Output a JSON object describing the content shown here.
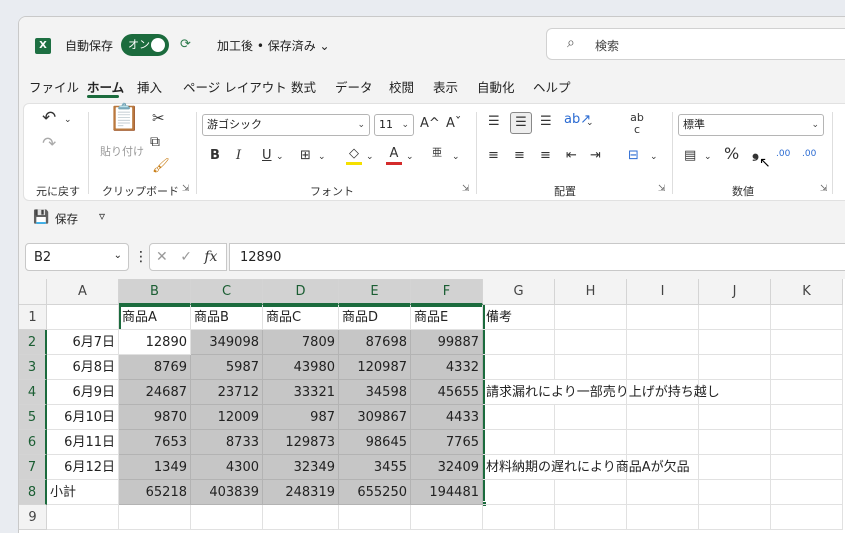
{
  "app": {
    "logo_letter": "X",
    "autosave_label": "自動保存",
    "autosave_state": "オン",
    "document_title": "加工後 • 保存済み ⌄",
    "search_placeholder": "検索"
  },
  "menu": [
    "ファイル",
    "ホーム",
    "挿入",
    "ページ レイアウト",
    "数式",
    "データ",
    "校閲",
    "表示",
    "自動化",
    "ヘルプ"
  ],
  "ribbon": {
    "undo_group": "元に戻す",
    "clipboard_group": "クリップボード",
    "paste_label": "貼り付け",
    "font_group": "フォント",
    "font_name": "游ゴシック",
    "font_size": "11",
    "align_group": "配置",
    "number_group": "数値",
    "number_format": "標準",
    "grow_font": "A^",
    "shrink_font": "Aˇ",
    "bold": "B",
    "italic": "I",
    "underline": "U",
    "font_color": "A",
    "percent": "%",
    "comma": "❟",
    "inc_decimal": ".00",
    "dec_decimal": ".00",
    "wrap": "ab c"
  },
  "qbar": {
    "save": "保存",
    "more": "▿"
  },
  "formula": {
    "name_box": "B2",
    "value": "12890",
    "fx": "fx"
  },
  "columns": [
    "A",
    "B",
    "C",
    "D",
    "E",
    "F",
    "G",
    "H",
    "I",
    "J",
    "K"
  ],
  "rows": [
    "1",
    "2",
    "3",
    "4",
    "5",
    "6",
    "7",
    "8",
    "9"
  ],
  "headers": [
    "商品A",
    "商品B",
    "商品C",
    "商品D",
    "商品E",
    "備考"
  ],
  "data": [
    {
      "date": "6月7日",
      "v": [
        "12890",
        "349098",
        "7809",
        "87698",
        "99887"
      ],
      "note": ""
    },
    {
      "date": "6月8日",
      "v": [
        "8769",
        "5987",
        "43980",
        "120987",
        "4332"
      ],
      "note": ""
    },
    {
      "date": "6月9日",
      "v": [
        "24687",
        "23712",
        "33321",
        "34598",
        "45655"
      ],
      "note": "請求漏れにより一部売り上げが持ち越し"
    },
    {
      "date": "6月10日",
      "v": [
        "9870",
        "12009",
        "987",
        "309867",
        "4433"
      ],
      "note": ""
    },
    {
      "date": "6月11日",
      "v": [
        "7653",
        "8733",
        "129873",
        "98645",
        "7765"
      ],
      "note": ""
    },
    {
      "date": "6月12日",
      "v": [
        "1349",
        "4300",
        "32349",
        "3455",
        "32409"
      ],
      "note": "材料納期の遅れにより商品Aが欠品"
    }
  ],
  "subtotal": {
    "label": "小計",
    "v": [
      "65218",
      "403839",
      "248319",
      "655250",
      "194481"
    ]
  },
  "colors": {
    "accent": "#1b6b3d",
    "selection": "#c6c6c6"
  }
}
